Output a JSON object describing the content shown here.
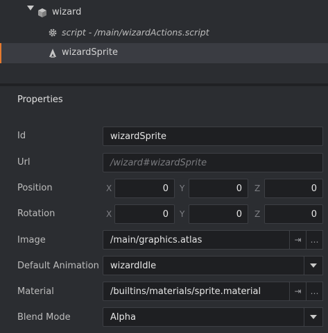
{
  "outline": {
    "root": {
      "label": "wizard",
      "icon": "gameobject-cube-icon"
    },
    "children": [
      {
        "label": "script - /main/wizardActions.script",
        "icon": "gear-icon"
      },
      {
        "label": "wizardSprite",
        "icon": "sprite-icon",
        "selected": true
      }
    ]
  },
  "properties": {
    "title": "Properties",
    "id": {
      "label": "Id",
      "value": "wizardSprite"
    },
    "url": {
      "label": "Url",
      "placeholder": "/wizard#wizardSprite"
    },
    "position": {
      "label": "Position",
      "x_label": "X",
      "y_label": "Y",
      "z_label": "Z",
      "x": "0",
      "y": "0",
      "z": "0"
    },
    "rotation": {
      "label": "Rotation",
      "x_label": "X",
      "y_label": "Y",
      "z_label": "Z",
      "x": "0",
      "y": "0",
      "z": "0"
    },
    "image": {
      "label": "Image",
      "value": "/main/graphics.atlas",
      "goto_glyph": "⇥",
      "browse_glyph": "…"
    },
    "default_animation": {
      "label": "Default Animation",
      "value": "wizardIdle"
    },
    "material": {
      "label": "Material",
      "value": "/builtins/materials/sprite.material",
      "goto_glyph": "⇥",
      "browse_glyph": "…"
    },
    "blend_mode": {
      "label": "Blend Mode",
      "value": "Alpha"
    }
  },
  "colors": {
    "accent": "#e57a2e",
    "panel": "#2b2d31",
    "field": "#1e1f22"
  }
}
